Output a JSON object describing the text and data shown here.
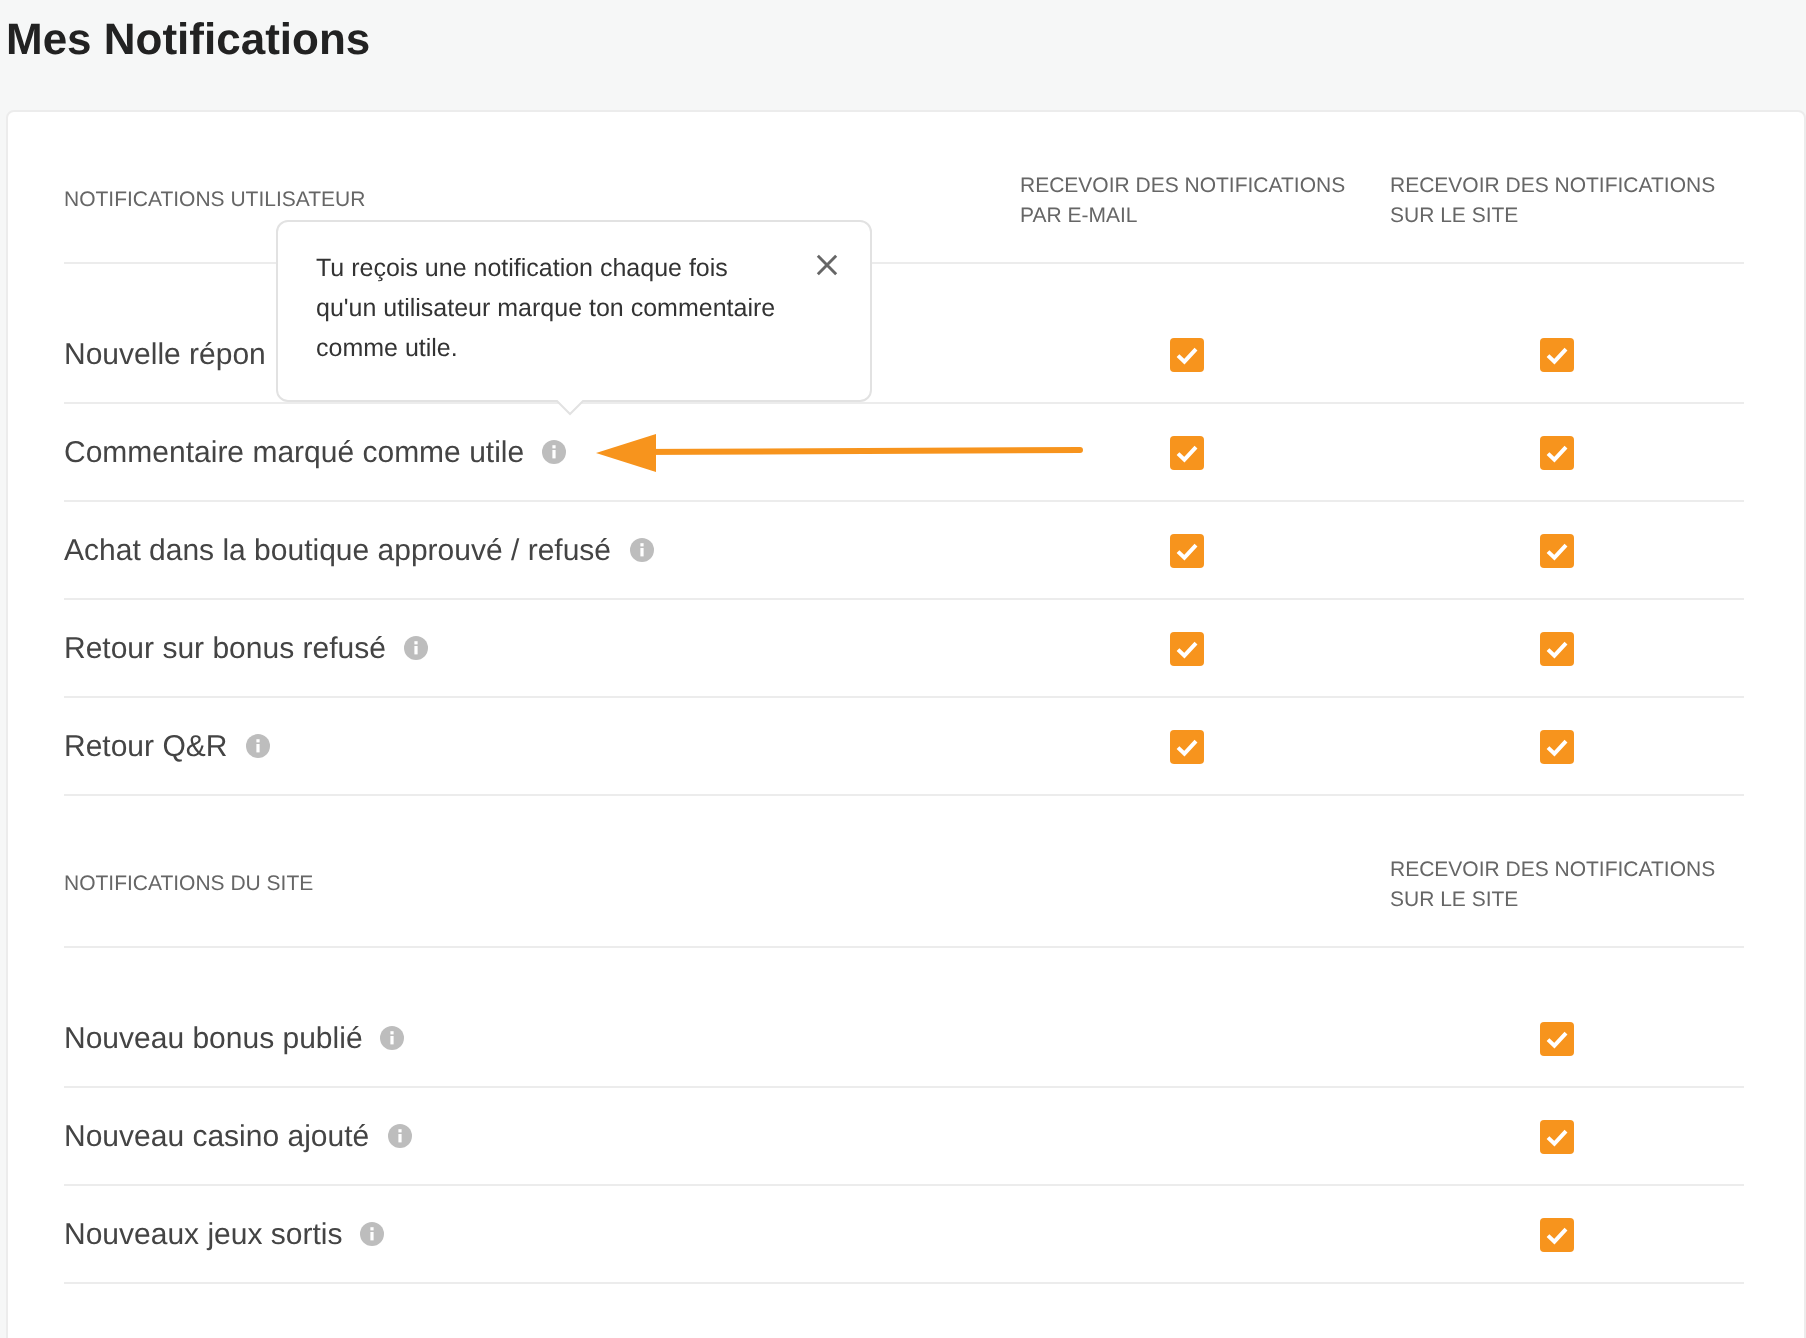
{
  "title": "Mes Notifications",
  "sections": [
    {
      "title": "NOTIFICATIONS UTILISATEUR",
      "columns": [
        {
          "kind": "email",
          "heading": "RECEVOIR DES NOTIFICATIONS PAR E-MAIL"
        },
        {
          "kind": "site",
          "heading": "RECEVOIR DES NOTIFICATIONS SUR LE SITE"
        }
      ],
      "rows": [
        {
          "label": "Nouvelle répon",
          "info": false,
          "email": true,
          "site": true
        },
        {
          "label": "Commentaire marqué comme utile",
          "info": true,
          "email": true,
          "site": true
        },
        {
          "label": "Achat dans la boutique approuvé / refusé",
          "info": true,
          "email": true,
          "site": true
        },
        {
          "label": "Retour sur bonus refusé",
          "info": true,
          "email": true,
          "site": true
        },
        {
          "label": "Retour Q&R",
          "info": true,
          "email": true,
          "site": true
        }
      ]
    },
    {
      "title": "NOTIFICATIONS DU SITE",
      "columns": [
        {
          "kind": "site",
          "heading": "RECEVOIR DES NOTIFICATIONS SUR LE SITE"
        }
      ],
      "rows": [
        {
          "label": "Nouveau bonus publié",
          "info": true,
          "site": true
        },
        {
          "label": "Nouveau casino ajouté",
          "info": true,
          "site": true
        },
        {
          "label": "Nouveaux jeux sortis",
          "info": true,
          "site": true
        }
      ]
    }
  ],
  "tooltip": {
    "text": "Tu reçois une notification chaque fois qu'un utilisateur marque ton commentaire comme utile."
  }
}
